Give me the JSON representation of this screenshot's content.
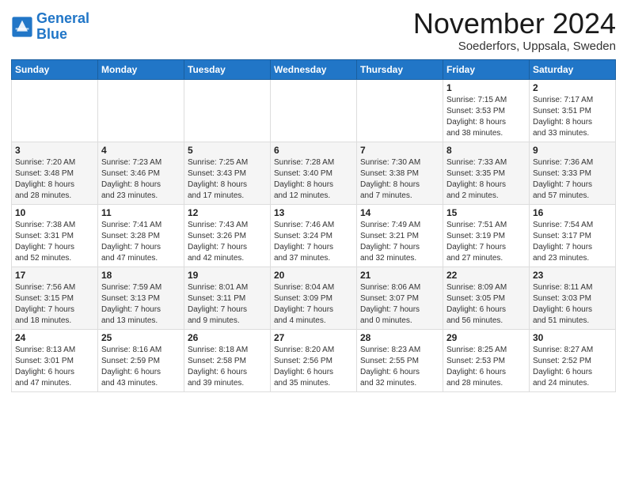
{
  "header": {
    "logo_line1": "General",
    "logo_line2": "Blue",
    "month_title": "November 2024",
    "location": "Soederfors, Uppsala, Sweden"
  },
  "weekdays": [
    "Sunday",
    "Monday",
    "Tuesday",
    "Wednesday",
    "Thursday",
    "Friday",
    "Saturday"
  ],
  "weeks": [
    [
      {
        "day": "",
        "content": ""
      },
      {
        "day": "",
        "content": ""
      },
      {
        "day": "",
        "content": ""
      },
      {
        "day": "",
        "content": ""
      },
      {
        "day": "",
        "content": ""
      },
      {
        "day": "1",
        "content": "Sunrise: 7:15 AM\nSunset: 3:53 PM\nDaylight: 8 hours\nand 38 minutes."
      },
      {
        "day": "2",
        "content": "Sunrise: 7:17 AM\nSunset: 3:51 PM\nDaylight: 8 hours\nand 33 minutes."
      }
    ],
    [
      {
        "day": "3",
        "content": "Sunrise: 7:20 AM\nSunset: 3:48 PM\nDaylight: 8 hours\nand 28 minutes."
      },
      {
        "day": "4",
        "content": "Sunrise: 7:23 AM\nSunset: 3:46 PM\nDaylight: 8 hours\nand 23 minutes."
      },
      {
        "day": "5",
        "content": "Sunrise: 7:25 AM\nSunset: 3:43 PM\nDaylight: 8 hours\nand 17 minutes."
      },
      {
        "day": "6",
        "content": "Sunrise: 7:28 AM\nSunset: 3:40 PM\nDaylight: 8 hours\nand 12 minutes."
      },
      {
        "day": "7",
        "content": "Sunrise: 7:30 AM\nSunset: 3:38 PM\nDaylight: 8 hours\nand 7 minutes."
      },
      {
        "day": "8",
        "content": "Sunrise: 7:33 AM\nSunset: 3:35 PM\nDaylight: 8 hours\nand 2 minutes."
      },
      {
        "day": "9",
        "content": "Sunrise: 7:36 AM\nSunset: 3:33 PM\nDaylight: 7 hours\nand 57 minutes."
      }
    ],
    [
      {
        "day": "10",
        "content": "Sunrise: 7:38 AM\nSunset: 3:31 PM\nDaylight: 7 hours\nand 52 minutes."
      },
      {
        "day": "11",
        "content": "Sunrise: 7:41 AM\nSunset: 3:28 PM\nDaylight: 7 hours\nand 47 minutes."
      },
      {
        "day": "12",
        "content": "Sunrise: 7:43 AM\nSunset: 3:26 PM\nDaylight: 7 hours\nand 42 minutes."
      },
      {
        "day": "13",
        "content": "Sunrise: 7:46 AM\nSunset: 3:24 PM\nDaylight: 7 hours\nand 37 minutes."
      },
      {
        "day": "14",
        "content": "Sunrise: 7:49 AM\nSunset: 3:21 PM\nDaylight: 7 hours\nand 32 minutes."
      },
      {
        "day": "15",
        "content": "Sunrise: 7:51 AM\nSunset: 3:19 PM\nDaylight: 7 hours\nand 27 minutes."
      },
      {
        "day": "16",
        "content": "Sunrise: 7:54 AM\nSunset: 3:17 PM\nDaylight: 7 hours\nand 23 minutes."
      }
    ],
    [
      {
        "day": "17",
        "content": "Sunrise: 7:56 AM\nSunset: 3:15 PM\nDaylight: 7 hours\nand 18 minutes."
      },
      {
        "day": "18",
        "content": "Sunrise: 7:59 AM\nSunset: 3:13 PM\nDaylight: 7 hours\nand 13 minutes."
      },
      {
        "day": "19",
        "content": "Sunrise: 8:01 AM\nSunset: 3:11 PM\nDaylight: 7 hours\nand 9 minutes."
      },
      {
        "day": "20",
        "content": "Sunrise: 8:04 AM\nSunset: 3:09 PM\nDaylight: 7 hours\nand 4 minutes."
      },
      {
        "day": "21",
        "content": "Sunrise: 8:06 AM\nSunset: 3:07 PM\nDaylight: 7 hours\nand 0 minutes."
      },
      {
        "day": "22",
        "content": "Sunrise: 8:09 AM\nSunset: 3:05 PM\nDaylight: 6 hours\nand 56 minutes."
      },
      {
        "day": "23",
        "content": "Sunrise: 8:11 AM\nSunset: 3:03 PM\nDaylight: 6 hours\nand 51 minutes."
      }
    ],
    [
      {
        "day": "24",
        "content": "Sunrise: 8:13 AM\nSunset: 3:01 PM\nDaylight: 6 hours\nand 47 minutes."
      },
      {
        "day": "25",
        "content": "Sunrise: 8:16 AM\nSunset: 2:59 PM\nDaylight: 6 hours\nand 43 minutes."
      },
      {
        "day": "26",
        "content": "Sunrise: 8:18 AM\nSunset: 2:58 PM\nDaylight: 6 hours\nand 39 minutes."
      },
      {
        "day": "27",
        "content": "Sunrise: 8:20 AM\nSunset: 2:56 PM\nDaylight: 6 hours\nand 35 minutes."
      },
      {
        "day": "28",
        "content": "Sunrise: 8:23 AM\nSunset: 2:55 PM\nDaylight: 6 hours\nand 32 minutes."
      },
      {
        "day": "29",
        "content": "Sunrise: 8:25 AM\nSunset: 2:53 PM\nDaylight: 6 hours\nand 28 minutes."
      },
      {
        "day": "30",
        "content": "Sunrise: 8:27 AM\nSunset: 2:52 PM\nDaylight: 6 hours\nand 24 minutes."
      }
    ]
  ]
}
